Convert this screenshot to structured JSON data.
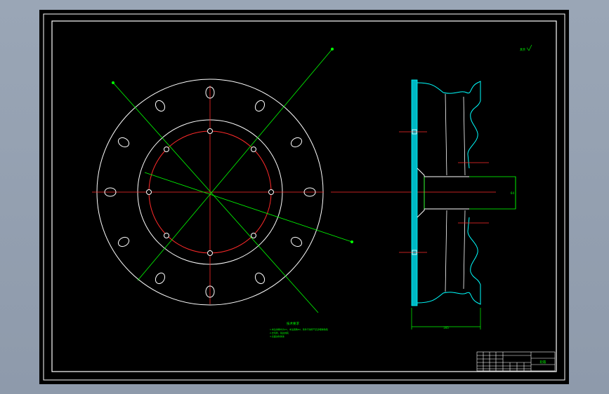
{
  "drawing": {
    "title_block_name": "轮毂",
    "tech_requirements_title": "技术要求",
    "tech_requirements": [
      "1.未注倒角均为C1，未注圆角R2，铸件不得有气孔砂眼等缺陷",
      "2.去毛刺，锐边倒钝",
      "3.表面涂防锈漆"
    ],
    "roughness_note": "其余",
    "dim_width": "165",
    "dim_hub": "64"
  },
  "colors": {
    "background": "#000000",
    "outline": "#ffffff",
    "centerline": "#ff2a2a",
    "construction": "#00ff00",
    "section": "#00ffff",
    "frame_outer": "#9aa6b6"
  }
}
